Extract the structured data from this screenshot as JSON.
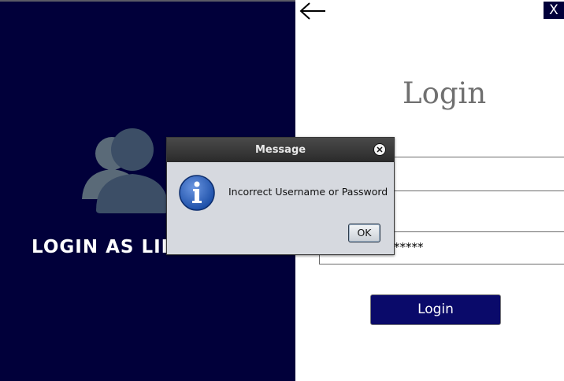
{
  "left_panel": {
    "title": "LOGIN AS LIB",
    "icon": "users-icon"
  },
  "right_panel": {
    "back_icon": "arrow-left-icon",
    "close_label": "X",
    "heading": "Login",
    "password_value": "*****",
    "login_button_label": "Login"
  },
  "dialog": {
    "title": "Message",
    "close_icon": "close-icon",
    "info_icon": "info-icon",
    "message": "Incorrect Username or Password",
    "ok_label": "OK"
  },
  "colors": {
    "panel": "#01003a",
    "button": "#0a0a6a",
    "dialog_bg": "#d6d9df"
  }
}
